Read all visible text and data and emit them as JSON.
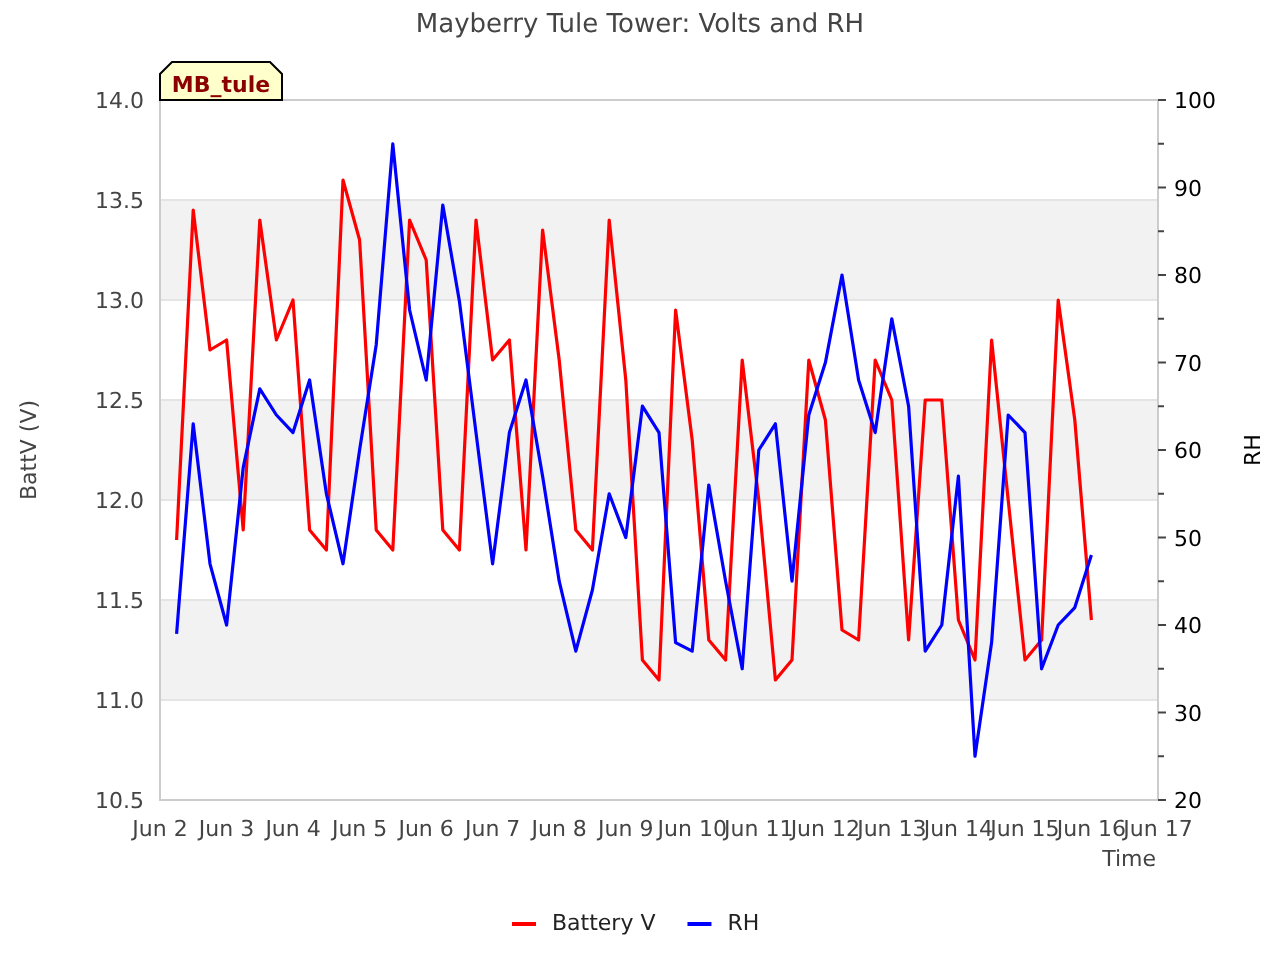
{
  "chart": {
    "badge": "MB_tule",
    "chart_data": {
      "type": "line",
      "title": "Mayberry Tule Tower: Volts and RH",
      "xlabel": "Time",
      "ylabel": "BattV (V)",
      "y2label": "RH",
      "grid": true,
      "legend": "bottom",
      "ylim": [
        10.5,
        14
      ],
      "y2lim": [
        20,
        100
      ],
      "categories": [
        "Jun 2",
        null,
        null,
        null,
        "Jun 3",
        null,
        null,
        null,
        "Jun 4",
        null,
        null,
        null,
        "Jun 5",
        null,
        null,
        null,
        "Jun 6",
        null,
        null,
        null,
        "Jun 7",
        null,
        null,
        null,
        "Jun 8",
        null,
        null,
        null,
        "Jun 9",
        null,
        null,
        null,
        "Jun 10",
        null,
        null,
        null,
        "Jun 11",
        null,
        null,
        null,
        "Jun 12",
        null,
        null,
        null,
        "Jun 13",
        null,
        null,
        null,
        "Jun 14",
        null,
        null,
        null,
        "Jun 15",
        null,
        null,
        null,
        "Jun 16",
        null,
        null,
        null,
        "Jun 17"
      ],
      "yticks": [
        {
          "value": 10.5,
          "label": "10.5"
        },
        {
          "value": 11,
          "label": "11.0"
        },
        {
          "value": 11.5,
          "label": "11.5"
        },
        {
          "value": 12,
          "label": "12.0"
        },
        {
          "value": 12.5,
          "label": "12.5"
        },
        {
          "value": 13,
          "label": "13.0"
        },
        {
          "value": 13.5,
          "label": "13.5"
        },
        {
          "value": 14,
          "label": "14.0"
        }
      ],
      "y2ticks": [
        20,
        30,
        40,
        50,
        60,
        70,
        80,
        90,
        100
      ],
      "series": [
        {
          "name": "Battery V",
          "color": "#ff0000",
          "values": [
            null,
            11.8,
            13.45,
            12.75,
            12.8,
            11.85,
            13.4,
            12.8,
            13.0,
            11.85,
            11.75,
            13.6,
            13.3,
            11.85,
            11.75,
            13.4,
            13.2,
            11.85,
            11.75,
            13.4,
            12.7,
            12.8,
            11.75,
            13.35,
            12.7,
            11.85,
            11.75,
            13.4,
            12.6,
            11.2,
            11.1,
            12.95,
            12.3,
            11.3,
            11.2,
            12.7,
            12.0,
            11.1,
            11.2,
            12.7,
            12.4,
            11.35,
            11.3,
            12.7,
            12.5,
            11.3,
            12.5,
            12.5,
            11.4,
            11.2,
            12.8,
            12.0,
            11.2,
            11.3,
            13.0,
            12.4,
            11.4,
            null,
            null,
            null,
            null
          ]
        },
        {
          "name": "RH",
          "color": "#0000ff",
          "axis": "y2",
          "values": [
            null,
            39,
            63,
            47,
            40,
            58,
            67,
            64,
            62,
            68,
            55,
            47,
            60,
            72,
            95,
            76,
            68,
            88,
            77,
            62,
            47,
            62,
            68,
            57,
            45,
            37,
            44,
            55,
            50,
            65,
            62,
            38,
            37,
            56,
            45,
            35,
            60,
            63,
            45,
            64,
            70,
            80,
            68,
            62,
            75,
            65,
            37,
            40,
            57,
            25,
            38,
            64,
            62,
            35,
            40,
            42,
            48,
            null,
            null,
            null,
            null
          ]
        }
      ]
    }
  }
}
